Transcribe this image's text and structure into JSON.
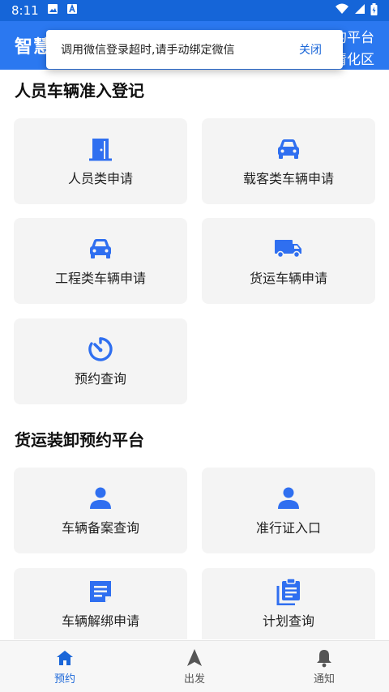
{
  "statusbar": {
    "time": "8:11"
  },
  "appbar": {
    "brand": "智慧",
    "right_line1": "的平台",
    "right_line2": "清化区"
  },
  "toast": {
    "message": "调用微信登录超时,请手动绑定微信",
    "action": "关闭"
  },
  "section1": {
    "title": "人员车辆准入登记",
    "cards": [
      {
        "label": "人员类申请",
        "icon": "door-icon"
      },
      {
        "label": "载客类车辆申请",
        "icon": "car-icon"
      },
      {
        "label": "工程类车辆申请",
        "icon": "car-icon"
      },
      {
        "label": "货运车辆申请",
        "icon": "truck-icon"
      },
      {
        "label": "预约查询",
        "icon": "timer-icon"
      }
    ]
  },
  "section2": {
    "title": "货运装卸预约平台",
    "cards": [
      {
        "label": "车辆备案查询",
        "icon": "person-icon"
      },
      {
        "label": "准行证入口",
        "icon": "person-icon"
      },
      {
        "label": "车辆解绑申请",
        "icon": "document-icon"
      },
      {
        "label": "计划查询",
        "icon": "clipboard-icon"
      }
    ]
  },
  "bottom_nav": [
    {
      "label": "预约",
      "icon": "home-icon",
      "active": true
    },
    {
      "label": "出发",
      "icon": "navigation-arrow-icon",
      "active": false
    },
    {
      "label": "通知",
      "icon": "bell-icon",
      "active": false
    }
  ],
  "colors": {
    "primary": "#2b78f0",
    "statusbar": "#1565d8",
    "icon_blue": "#2f6ff0",
    "card_bg": "#f4f4f4"
  }
}
